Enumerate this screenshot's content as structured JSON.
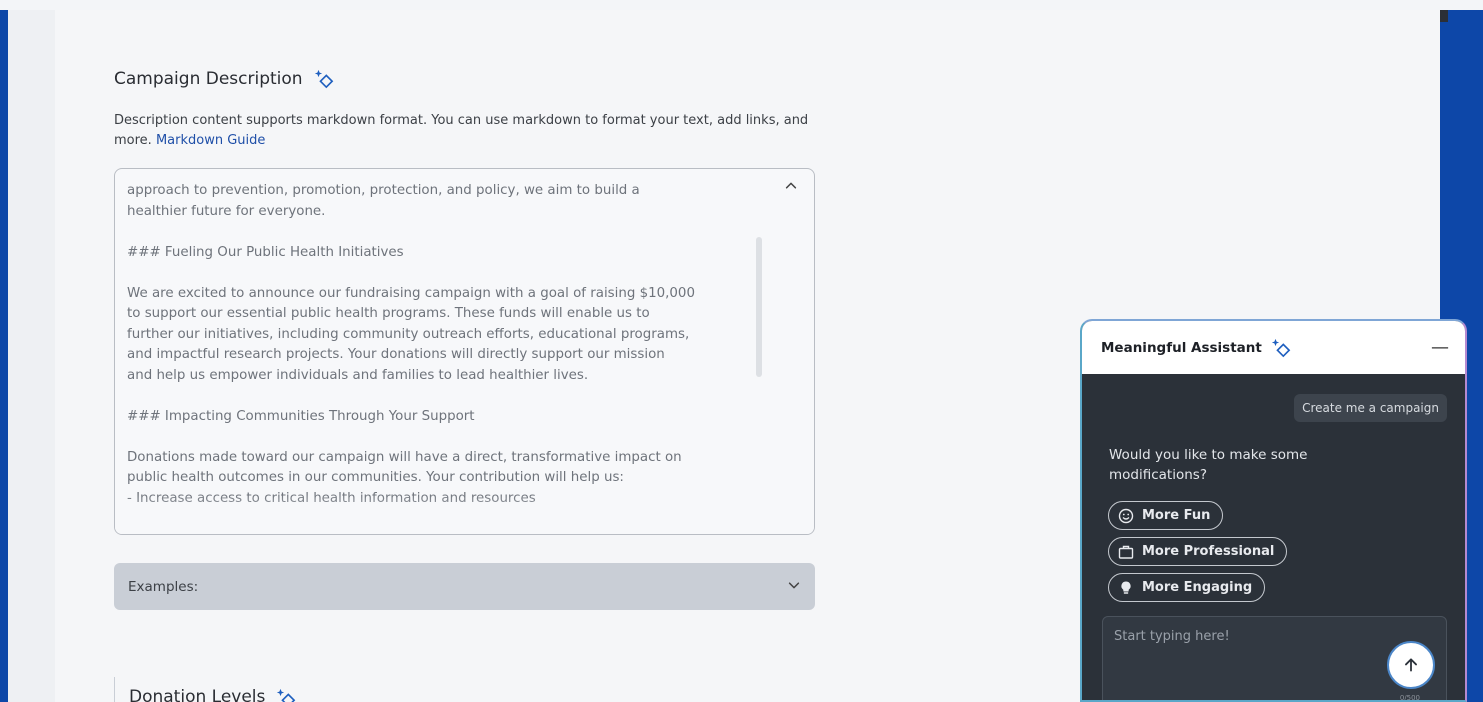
{
  "description_section": {
    "title": "Campaign Description",
    "help_text": "Description content supports markdown format. You can use markdown to format your text, add links, and more.",
    "help_link": "Markdown Guide",
    "editor_content": "approach to prevention, promotion, protection, and policy, we aim to build a\nhealthier future for everyone.\n\n### Fueling Our Public Health Initiatives\n\nWe are excited to announce our fundraising campaign with a goal of raising $10,000\nto support our essential public health programs. These funds will enable us to\nfurther our initiatives, including community outreach efforts, educational programs,\nand impactful research projects. Your donations will directly support our mission\nand help us empower individuals and families to lead healthier lives.\n\n### Impacting Communities Through Your Support\n\nDonations made toward our campaign will have a direct, transformative impact on\npublic health outcomes in our communities. Your contribution will help us:\n- Increase access to critical health information and resources"
  },
  "examples": {
    "label": "Examples:"
  },
  "donation_section": {
    "title": "Donation Levels"
  },
  "assistant": {
    "title": "Meaningful Assistant",
    "minimize": "—",
    "user_message": "Create me a campaign",
    "assistant_message": "Would you like to make some modifications?",
    "chips": [
      {
        "label": "More Fun",
        "icon": "smiley-icon"
      },
      {
        "label": "More Professional",
        "icon": "briefcase-icon"
      },
      {
        "label": "More Engaging",
        "icon": "lightbulb-icon"
      }
    ],
    "input_placeholder": "Start typing here!",
    "char_counter": "0/500"
  },
  "colors": {
    "brand_blue": "#0d47a8",
    "link_blue": "#1f4fa8",
    "assistant_bg": "#2b3139",
    "sparkle_blue": "#1f5fbf"
  }
}
